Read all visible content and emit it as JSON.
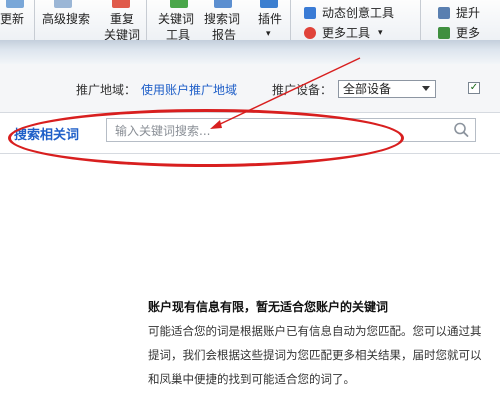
{
  "toolbar": {
    "update_label": "更新",
    "advanced_search_label": "高级搜索",
    "duplicate_label_1": "重复",
    "duplicate_label_2": "关键词",
    "keyword_tool_label_1": "关键词",
    "keyword_tool_label_2": "工具",
    "search_report_label_1": "搜索词",
    "search_report_label_2": "报告",
    "plugin_label": "插件",
    "plugin_arrow": "▾",
    "dynamic_creative_label": "动态创意工具",
    "more_tools_label": "更多工具",
    "more_tools_arrow": "▾",
    "promote_label": "提升",
    "more_label": "更多"
  },
  "filters": {
    "region_label": "推广地域：",
    "region_link": "使用账户推广地域",
    "device_label": "推广设备：",
    "device_value": "全部设备",
    "checkbox_mark": "✓"
  },
  "search": {
    "title": "搜索相关词",
    "placeholder": "输入关键词搜索..."
  },
  "empty_state": {
    "title": "账户现有信息有限，暂无适合您账户的关键词",
    "line1": "可能适合您的词是根据账户已有信息自动为您匹配。您可以通过其",
    "line2": "提词，我们会根据这些提词为您匹配更多相关结果，届时您就可以",
    "line3": "和凤巢中便捷的找到可能适合您的词了。"
  },
  "colors": {
    "accent_blue": "#1f5fc8",
    "annotation_red": "#d81f1f"
  }
}
